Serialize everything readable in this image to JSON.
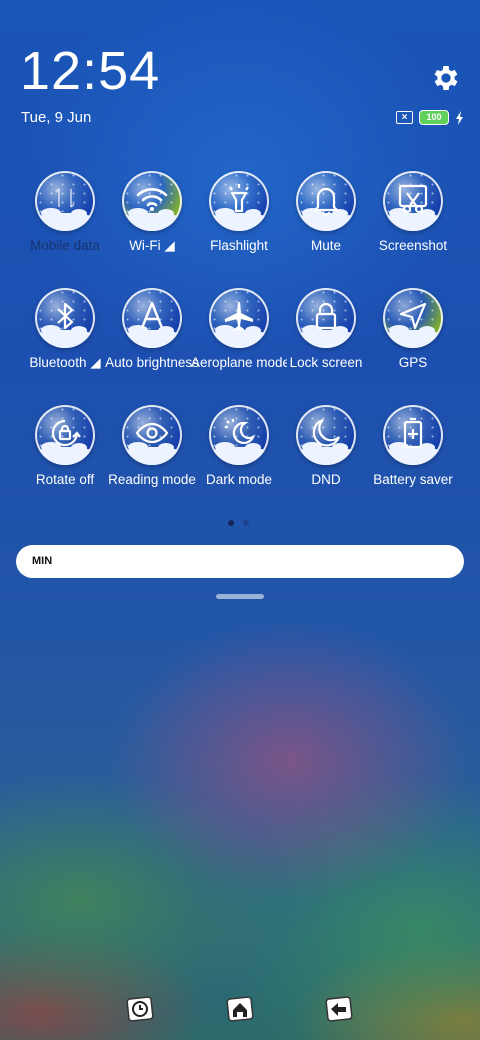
{
  "status": {
    "time": "12:54",
    "date": "Tue, 9 Jun",
    "sim_icon": "sim-x-icon",
    "battery": "100",
    "charging_icon": "bolt-icon"
  },
  "tiles": [
    {
      "label": "Mobile data",
      "icon": "mobile-data-icon",
      "active": false
    },
    {
      "label": "Wi-Fi ◢",
      "icon": "wifi-icon",
      "active": true
    },
    {
      "label": "Flashlight",
      "icon": "flashlight-icon",
      "active": false
    },
    {
      "label": "Mute",
      "icon": "bell-icon",
      "active": false
    },
    {
      "label": "Screenshot",
      "icon": "scissors-icon",
      "active": false
    },
    {
      "label": "Bluetooth ◢",
      "icon": "bluetooth-icon",
      "active": false
    },
    {
      "label": "Auto brightness",
      "icon": "auto-brightness-icon",
      "active": false
    },
    {
      "label": "Aeroplane mode",
      "icon": "aeroplane-icon",
      "active": false
    },
    {
      "label": "Lock screen",
      "icon": "lock-icon",
      "active": false
    },
    {
      "label": "GPS",
      "icon": "gps-icon",
      "active": true
    },
    {
      "label": "Rotate off",
      "icon": "rotate-lock-icon",
      "active": false
    },
    {
      "label": "Reading mode",
      "icon": "eye-icon",
      "active": false
    },
    {
      "label": "Dark mode",
      "icon": "dark-mode-icon",
      "active": false
    },
    {
      "label": "DND",
      "icon": "moon-icon",
      "active": false
    },
    {
      "label": "Battery saver",
      "icon": "battery-saver-icon",
      "active": false
    }
  ],
  "brightness": {
    "label": "MIN"
  },
  "nav": {
    "recents": "clock-icon",
    "home": "home-icon",
    "back": "back-arrow-icon"
  },
  "colors": {
    "active": "#7fae2c",
    "bubble": "#1a47b8"
  }
}
